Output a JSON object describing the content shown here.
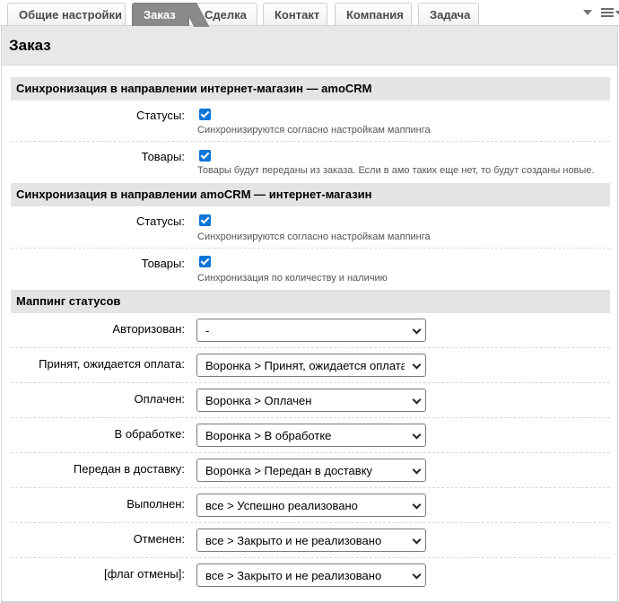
{
  "tabs": [
    {
      "label": "Общие настройки",
      "active": false
    },
    {
      "label": "Заказ",
      "active": true
    },
    {
      "label": "Сделка",
      "active": false
    },
    {
      "label": "Контакт",
      "active": false
    },
    {
      "label": "Компания",
      "active": false
    },
    {
      "label": "Задача",
      "active": false
    }
  ],
  "page": {
    "title": "Заказ"
  },
  "section_shop_to_crm": {
    "title": "Синхронизация в направлении интернет-магазин — amoCRM",
    "statuses": {
      "label": "Статусы:",
      "checked": true,
      "hint": "Синхронизируются согласно настройкам маппинга"
    },
    "goods": {
      "label": "Товары:",
      "checked": true,
      "hint": "Товары будут переданы из заказа. Если в амо таких еще нет, то будут созданы новые."
    }
  },
  "section_crm_to_shop": {
    "title": "Синхронизация в направлении amoCRM — интернет-магазин",
    "statuses": {
      "label": "Статусы:",
      "checked": true,
      "hint": "Синхронизируются согласно настройкам маппинга"
    },
    "goods": {
      "label": "Товары:",
      "checked": true,
      "hint": "Синхронизация по количеству и наличию"
    }
  },
  "mapping": {
    "title": "Маппинг статусов",
    "rows": [
      {
        "label": "Авторизован:",
        "value": "-"
      },
      {
        "label": "Принят, ожидается оплата:",
        "value": "Воронка > Принят, ожидается оплата"
      },
      {
        "label": "Оплачен:",
        "value": "Воронка > Оплачен"
      },
      {
        "label": "В обработке:",
        "value": "Воронка > В обработке"
      },
      {
        "label": "Передан в доставку:",
        "value": "Воронка > Передан в доставку"
      },
      {
        "label": "Выполнен:",
        "value": "все > Успешно реализовано"
      },
      {
        "label": "Отменен:",
        "value": "все > Закрыто и не реализовано"
      },
      {
        "label": "[флаг отмены]:",
        "value": "все > Закрыто и не реализовано"
      }
    ]
  }
}
